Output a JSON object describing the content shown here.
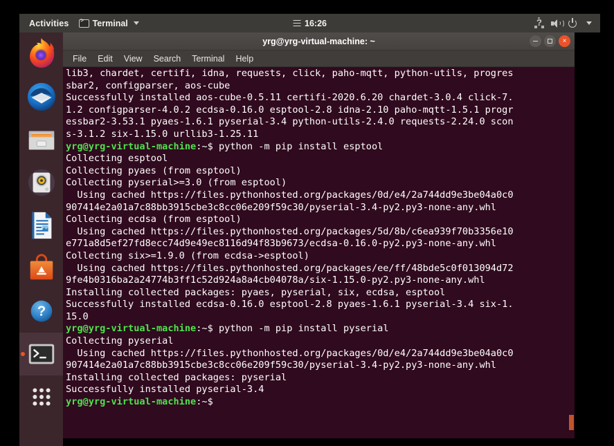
{
  "topbar": {
    "activities_label": "Activities",
    "app_menu_label": "Terminal",
    "clock": "16:26",
    "icons": {
      "app_icon": "terminal-icon",
      "calendar_icon": "calendar-icon",
      "network_icon": "network-unknown-icon",
      "volume_icon": "volume-icon",
      "power_icon": "power-icon",
      "dropdown_icon": "chevron-down-icon"
    }
  },
  "dock": {
    "items": [
      {
        "name": "firefox",
        "label": "Firefox",
        "active": false
      },
      {
        "name": "thunderbird",
        "label": "Thunderbird Mail",
        "active": false
      },
      {
        "name": "files",
        "label": "Files",
        "active": false
      },
      {
        "name": "rhythmbox",
        "label": "Rhythmbox",
        "active": false
      },
      {
        "name": "libreoffice-writer",
        "label": "LibreOffice Writer",
        "active": false
      },
      {
        "name": "ubuntu-software",
        "label": "Ubuntu Software",
        "active": false
      },
      {
        "name": "help",
        "label": "Help",
        "active": false
      },
      {
        "name": "terminal",
        "label": "Terminal",
        "active": true
      },
      {
        "name": "show-applications",
        "label": "Show Applications",
        "active": false
      }
    ]
  },
  "window": {
    "title": "yrg@yrg-virtual-machine: ~",
    "menu": [
      "File",
      "Edit",
      "View",
      "Search",
      "Terminal",
      "Help"
    ],
    "controls": {
      "minimize": "–",
      "maximize": "□",
      "close": "×"
    }
  },
  "terminal": {
    "prompt_user_host": "yrg@yrg-virtual-machine",
    "prompt_suffix": ":~$ ",
    "lines": [
      {
        "type": "out",
        "text": "lib3, chardet, certifi, idna, requests, click, paho-mqtt, python-utils, progres"
      },
      {
        "type": "out",
        "text": "sbar2, configparser, aos-cube"
      },
      {
        "type": "out",
        "text": "Successfully installed aos-cube-0.5.11 certifi-2020.6.20 chardet-3.0.4 click-7."
      },
      {
        "type": "out",
        "text": "1.2 configparser-4.0.2 ecdsa-0.16.0 esptool-2.8 idna-2.10 paho-mqtt-1.5.1 progr"
      },
      {
        "type": "out",
        "text": "essbar2-3.53.1 pyaes-1.6.1 pyserial-3.4 python-utils-2.4.0 requests-2.24.0 scon"
      },
      {
        "type": "out",
        "text": "s-3.1.2 six-1.15.0 urllib3-1.25.11"
      },
      {
        "type": "cmd",
        "command": "python -m pip install esptool"
      },
      {
        "type": "out",
        "text": "Collecting esptool"
      },
      {
        "type": "out",
        "text": "Collecting pyaes (from esptool)"
      },
      {
        "type": "out",
        "text": "Collecting pyserial>=3.0 (from esptool)"
      },
      {
        "type": "out",
        "text": "  Using cached https://files.pythonhosted.org/packages/0d/e4/2a744dd9e3be04a0c0"
      },
      {
        "type": "out",
        "text": "907414e2a01a7c88bb3915cbe3c8cc06e209f59c30/pyserial-3.4-py2.py3-none-any.whl"
      },
      {
        "type": "out",
        "text": "Collecting ecdsa (from esptool)"
      },
      {
        "type": "out",
        "text": "  Using cached https://files.pythonhosted.org/packages/5d/8b/c6ea939f70b3356e10"
      },
      {
        "type": "out",
        "text": "e771a8d5ef27fd8ecc74d9e49ec8116d94f83b9673/ecdsa-0.16.0-py2.py3-none-any.whl"
      },
      {
        "type": "out",
        "text": "Collecting six>=1.9.0 (from ecdsa->esptool)"
      },
      {
        "type": "out",
        "text": "  Using cached https://files.pythonhosted.org/packages/ee/ff/48bde5c0f013094d72"
      },
      {
        "type": "out",
        "text": "9fe4b0316ba2a24774b3ff1c52d924a8a4cb04078a/six-1.15.0-py2.py3-none-any.whl"
      },
      {
        "type": "out",
        "text": "Installing collected packages: pyaes, pyserial, six, ecdsa, esptool"
      },
      {
        "type": "out",
        "text": "Successfully installed ecdsa-0.16.0 esptool-2.8 pyaes-1.6.1 pyserial-3.4 six-1."
      },
      {
        "type": "out",
        "text": "15.0"
      },
      {
        "type": "cmd",
        "command": "python -m pip install pyserial"
      },
      {
        "type": "out",
        "text": "Collecting pyserial"
      },
      {
        "type": "out",
        "text": "  Using cached https://files.pythonhosted.org/packages/0d/e4/2a744dd9e3be04a0c0"
      },
      {
        "type": "out",
        "text": "907414e2a01a7c88bb3915cbe3c8cc06e209f59c30/pyserial-3.4-py2.py3-none-any.whl"
      },
      {
        "type": "out",
        "text": "Installing collected packages: pyserial"
      },
      {
        "type": "out",
        "text": "Successfully installed pyserial-3.4"
      },
      {
        "type": "cmd",
        "command": ""
      }
    ]
  },
  "colors": {
    "terminal_bg": "#300a1e",
    "prompt_green": "#4ee24e",
    "accent_orange": "#e8561f",
    "topbar_bg": "#3c3b37",
    "dock_bg": "#3b262c"
  }
}
